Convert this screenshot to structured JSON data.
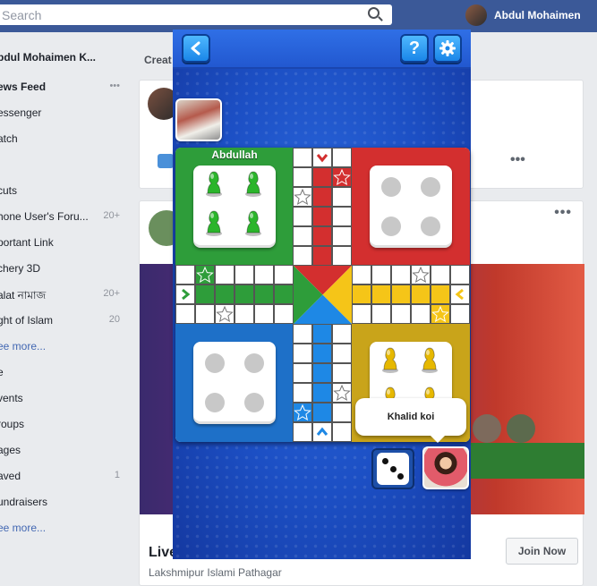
{
  "facebook": {
    "search_placeholder": "Search",
    "user_name": "Abdul Mohaimen",
    "profile_name": "bdul Mohaimen K...",
    "create_label": "Creat",
    "nav": [
      {
        "label": "ews Feed",
        "count": "•••",
        "bold": true
      },
      {
        "label": "essenger",
        "count": ""
      },
      {
        "label": "atch",
        "count": ""
      },
      {
        "label": "",
        "count": ""
      },
      {
        "label": "cuts",
        "count": ""
      },
      {
        "label": "hone User's Foru...",
        "count": "20+"
      },
      {
        "label": "portant Link",
        "count": ""
      },
      {
        "label": "chery 3D",
        "count": ""
      },
      {
        "label": "alat নামাজ",
        "count": "20+"
      },
      {
        "label": "ght of Islam",
        "count": "20"
      },
      {
        "label": "ee more...",
        "count": "",
        "more": true
      },
      {
        "label": "e",
        "count": ""
      },
      {
        "label": "vents",
        "count": ""
      },
      {
        "label": "roups",
        "count": ""
      },
      {
        "label": "ages",
        "count": ""
      },
      {
        "label": "aved",
        "count": "1"
      },
      {
        "label": "undraisers",
        "count": ""
      },
      {
        "label": "ee more...",
        "count": "",
        "more": true
      }
    ],
    "post_title": "Live ...",
    "post_subtitle": "Lakshmipur Islami Pathagar",
    "join_button": "Join Now",
    "menu_dots": "•••"
  },
  "game": {
    "back_icon": "back-arrow-icon",
    "help_label": "?",
    "settings_icon": "gear-icon",
    "player_top_name": "Abdullah",
    "player_bottom_name": "Khalid koi",
    "dice_value": "3",
    "colors": {
      "green": "#2e9d3a",
      "red": "#d32f2f",
      "blue": "#1e70c8",
      "yellow": "#f5c518",
      "board_bg": "#1c4fc4"
    },
    "homes": [
      {
        "color": "green",
        "tokens": 4
      },
      {
        "color": "red",
        "tokens": 0
      },
      {
        "color": "blue",
        "tokens": 0
      },
      {
        "color": "yellow",
        "tokens": 4
      }
    ]
  }
}
